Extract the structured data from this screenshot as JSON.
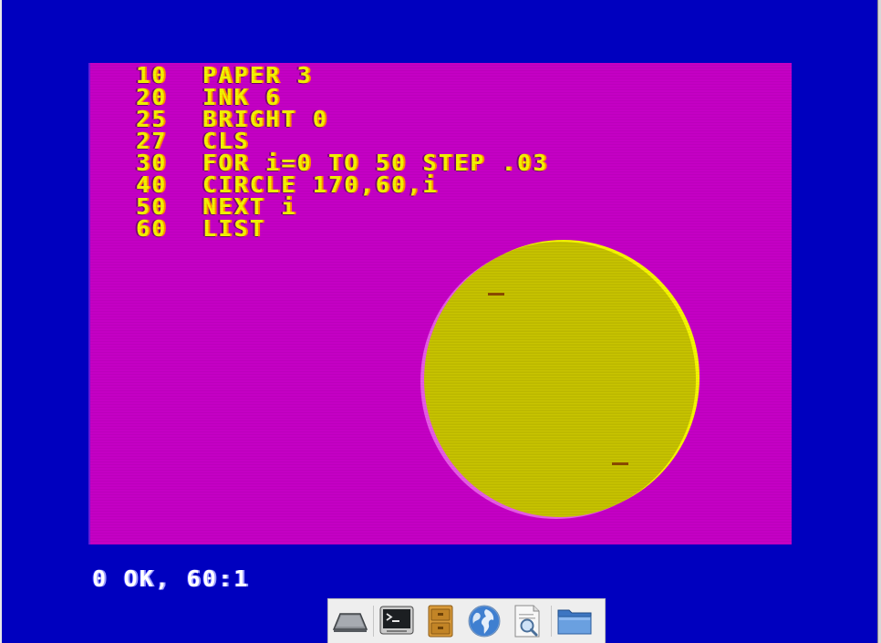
{
  "program": {
    "lines": [
      {
        "num": "10",
        "code": "PAPER 3"
      },
      {
        "num": "20",
        "code": "INK 6"
      },
      {
        "num": "25",
        "code": "BRIGHT 0"
      },
      {
        "num": "27",
        "code": "CLS"
      },
      {
        "num": "30",
        "code": "FOR i=0 TO 50 STEP .03"
      },
      {
        "num": "40",
        "code": "CIRCLE 170,60,i"
      },
      {
        "num": "50",
        "code": "NEXT i"
      },
      {
        "num": "60",
        "code": "LIST"
      }
    ]
  },
  "status": {
    "message": "0 OK, 60:1"
  },
  "colors": {
    "border": "#0000bf",
    "paper": "#c400c4",
    "ink": "#c8c400",
    "listing_text": "#f2f200",
    "status_text": "#ffffff"
  },
  "dock": {
    "items": [
      {
        "icon": "show-desktop-icon"
      },
      {
        "icon": "terminal-icon"
      },
      {
        "icon": "file-cabinet-icon"
      },
      {
        "icon": "web-browser-globe-icon"
      },
      {
        "icon": "document-viewer-icon"
      },
      {
        "icon": "folder-icon"
      }
    ]
  }
}
